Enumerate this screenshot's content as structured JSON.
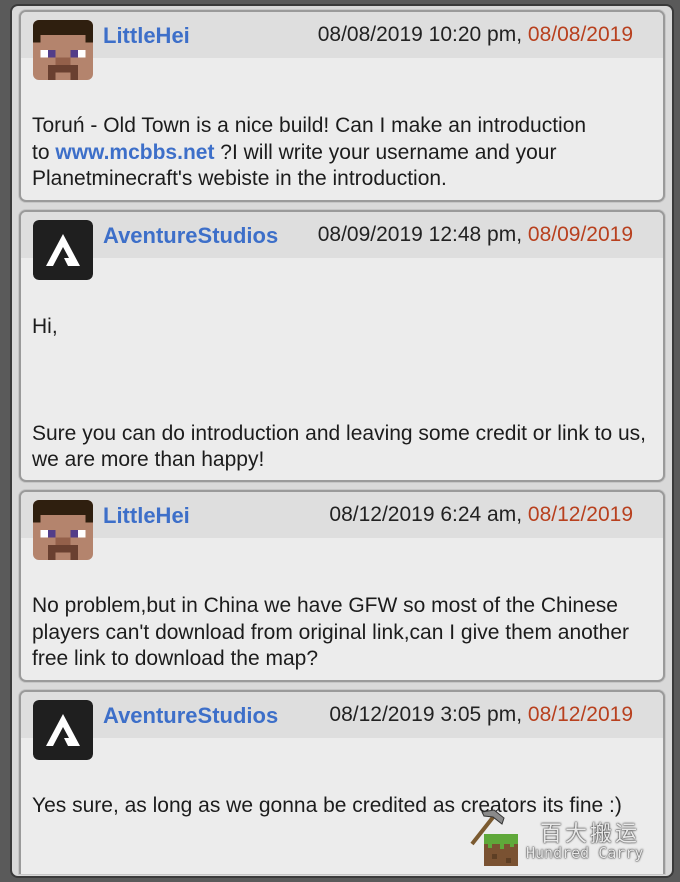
{
  "posts": [
    {
      "username": "LittleHei",
      "avatar": "minecraft-steve-avatar",
      "date": "08/08/2019 10:20 pm",
      "separator": ", ",
      "edit_date": "08/08/2019",
      "body": {
        "line1": "Toruń - Old Town is a nice build! Can I make an introduction",
        "to_prefix": "to ",
        "link": "www.mcbbs.net",
        "after_link": " ?I will write your username and your",
        "line3": "Planetminecraft's webiste in the introduction."
      }
    },
    {
      "username": "AventureStudios",
      "avatar": "aventure-studios-logo",
      "date": "08/09/2019 12:48 pm",
      "separator": ", ",
      "edit_date": "08/09/2019",
      "body": {
        "greeting": "Hi,",
        "text": "Sure you can do introduction and leaving some credit or link to us, we are more than happy!"
      }
    },
    {
      "username": "LittleHei",
      "avatar": "minecraft-steve-avatar",
      "date": "08/12/2019 6:24 am",
      "separator": ", ",
      "edit_date": "08/12/2019",
      "body": {
        "text": "No problem,but in China we have GFW so most of the Chinese players can't download from original link,can I give them another free link to download the map?"
      }
    },
    {
      "username": "AventureStudios",
      "avatar": "aventure-studios-logo",
      "date": "08/12/2019 3:05 pm",
      "separator": ", ",
      "edit_date": "08/12/2019",
      "body": {
        "text": "Yes sure, as long as we gonna be credited as creators its fine :)"
      }
    }
  ],
  "watermark": {
    "chinese": "百大搬运",
    "english": "Hundred Carry",
    "icon": "pickaxe-grass-block-icon"
  },
  "colors": {
    "username": "#3d6fc9",
    "link": "#3d6fc9",
    "edit_date": "#b8401e",
    "background": "#d9d9d9"
  }
}
